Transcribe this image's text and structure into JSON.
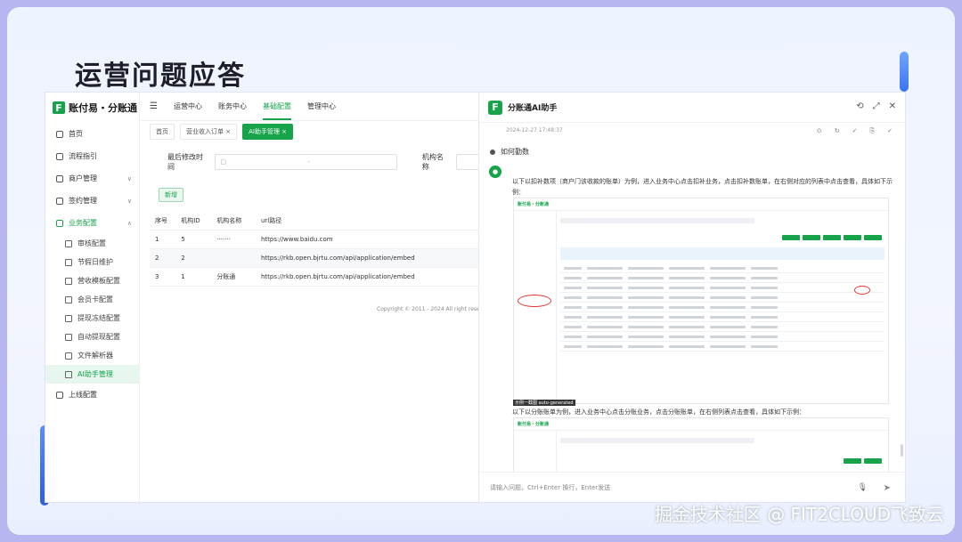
{
  "slide": {
    "title": "运营问题应答",
    "watermark": "掘金技术社区 @ FIT2CLOUD飞致云"
  },
  "admin": {
    "brand": "F",
    "brand_name": "账付易・分账通",
    "sidebar": [
      {
        "label": "首页",
        "icon": "home-icon"
      },
      {
        "label": "流程指引",
        "icon": "pin-icon"
      },
      {
        "label": "商户管理",
        "icon": "store-icon"
      },
      {
        "label": "签约管理",
        "icon": "contract-icon"
      },
      {
        "label": "业务配置",
        "icon": "config-icon"
      }
    ],
    "sub_items": [
      {
        "label": "审核配置"
      },
      {
        "label": "节假日维护"
      },
      {
        "label": "营收模板配置"
      },
      {
        "label": "会员卡配置"
      },
      {
        "label": "提现冻结配置"
      },
      {
        "label": "自动提现配置"
      },
      {
        "label": "文件解析器"
      },
      {
        "label": "AI助手管理"
      }
    ],
    "bottom_item": "上线配置",
    "top_nav": [
      "运营中心",
      "账务中心",
      "基础配置",
      "管理中心"
    ],
    "active_top": "基础配置",
    "tabs": [
      "首页",
      "营业收入订单 ×",
      "AI助手管理 ×"
    ],
    "filter_label": "最后修改时间",
    "filter_sep": "-",
    "filter_label2": "机构名称",
    "add_button": "新增",
    "table": {
      "headers": [
        "序号",
        "机构ID",
        "机构名称",
        "url路径"
      ],
      "rows": [
        [
          "1",
          "5",
          "·······",
          "https://www.baidu.com"
        ],
        [
          "2",
          "2",
          "",
          "https://rkb.open.bjrtu.com/api/application/embed"
        ],
        [
          "3",
          "1",
          "分账通",
          "https://rkb.open.bjrtu.com/api/application/embed"
        ]
      ]
    },
    "copyright": "Copyright © 2011 - 2024 All right rese"
  },
  "assistant": {
    "logo": "F",
    "title": "分账通AI助手",
    "date": "2024-12-27 17:48:37",
    "question": "如何勤数",
    "answer1": "以下以扣补数项（商户门该收款的账单）为例，进入业务中心点击扣补业务，点击扣补数账单，在右侧对应的列表中点击查看，具体如下示例：",
    "caption": "示例一截图 auto-generated",
    "answer2": "以下以分账账单为例，进入业务中心点击分账业务，点击分账账单，在右侧列表点击查看，具体如下示例：",
    "input_placeholder": "请输入问题，Ctrl+Enter 换行，Enter发送",
    "mini_brand": "账付易・分账通"
  }
}
